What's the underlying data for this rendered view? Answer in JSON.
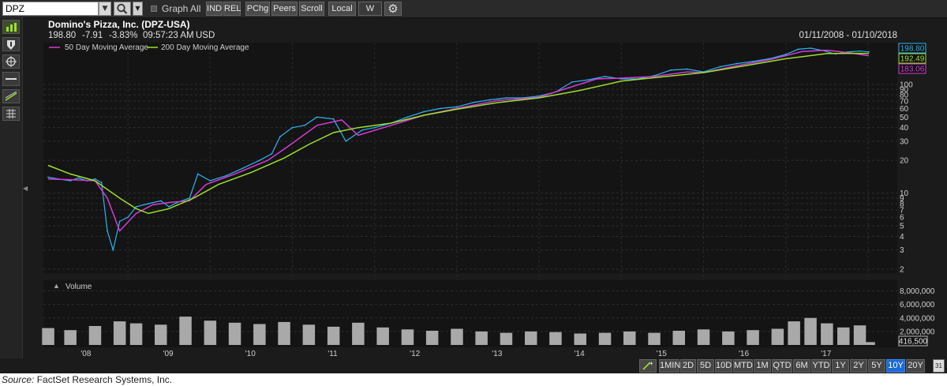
{
  "toolbar": {
    "ticker": "DPZ",
    "graph_all_label": "Graph All",
    "buttons": [
      "IND",
      "REL",
      "PChg",
      "Peers",
      "Scroll",
      "Local",
      "W"
    ]
  },
  "header": {
    "title": "Domino's Pizza, Inc. (DPZ-USA)",
    "price": "198.80",
    "change": "-7.91",
    "change_pct": "-3.83%",
    "time": "09:57:23 AM",
    "currency": "USD",
    "date_range": "01/11/2008 - 01/10/2018"
  },
  "legend": [
    {
      "label": "50 Day Moving Average",
      "color": "#d63bd6"
    },
    {
      "label": "200 Day Moving Average",
      "color": "#9be02a"
    }
  ],
  "price_tags": [
    {
      "value": "198.80",
      "color": "#2db4f0"
    },
    {
      "value": "192.49",
      "color": "#9be02a"
    },
    {
      "value": "183.06",
      "color": "#d63bd6"
    }
  ],
  "volume_label": "Volume",
  "volume_last": "416,500",
  "range_buttons": [
    "1MIN",
    "2D",
    "5D",
    "10D",
    "MTD",
    "1M",
    "QTD",
    "6M",
    "YTD",
    "1Y",
    "2Y",
    "5Y",
    "10Y",
    "20Y"
  ],
  "active_range": "10Y",
  "calendar_label": "31",
  "source": {
    "label": "Source:",
    "text": " FactSet Research Systems, Inc."
  },
  "colors": {
    "price": "#2db4f0",
    "ma50": "#d63bd6",
    "ma200": "#9be02a",
    "volume": "#a9a9a9",
    "active": "#1e6bd6"
  },
  "chart_data": {
    "type": "line",
    "title": "Domino's Pizza, Inc. (DPZ-USA)",
    "scale": "log",
    "x_labels": [
      "'08",
      "'09",
      "'10",
      "'11",
      "'12",
      "'13",
      "'14",
      "'15",
      "'16",
      "'17"
    ],
    "y_ticks": [
      2,
      3,
      4,
      5,
      6,
      7,
      8,
      9,
      10,
      20,
      30,
      40,
      50,
      60,
      70,
      80,
      90,
      100
    ],
    "series": [
      {
        "name": "DPZ",
        "x": [
          2008.03,
          2008.15,
          2008.3,
          2008.4,
          2008.5,
          2008.6,
          2008.68,
          2008.75,
          2008.82,
          2008.9,
          2009.0,
          2009.1,
          2009.25,
          2009.4,
          2009.5,
          2009.6,
          2009.75,
          2009.85,
          2010.0,
          2010.2,
          2010.4,
          2010.6,
          2010.75,
          2010.85,
          2011.0,
          2011.15,
          2011.3,
          2011.5,
          2011.65,
          2011.85,
          2012.0,
          2012.2,
          2012.4,
          2012.6,
          2012.8,
          2013.0,
          2013.2,
          2013.4,
          2013.6,
          2013.8,
          2014.0,
          2014.2,
          2014.4,
          2014.6,
          2014.8,
          2015.0,
          2015.2,
          2015.4,
          2015.6,
          2015.8,
          2016.0,
          2016.2,
          2016.4,
          2016.6,
          2016.8,
          2017.0,
          2017.15,
          2017.3,
          2017.45,
          2017.6,
          2017.75,
          2017.9,
          2018.01
        ],
        "values": [
          14,
          13.5,
          13,
          13.8,
          13,
          13.5,
          12.5,
          4.5,
          3,
          5.5,
          6,
          7.5,
          8,
          8.5,
          7.5,
          8.2,
          9,
          15,
          13,
          14.5,
          17,
          20,
          23,
          33,
          40,
          42,
          50,
          48,
          30,
          38,
          40,
          44,
          50,
          56,
          60,
          62,
          68,
          72,
          75,
          75,
          78,
          85,
          105,
          110,
          118,
          112,
          112,
          120,
          135,
          138,
          130,
          145,
          155,
          162,
          172,
          188,
          210,
          215,
          205,
          190,
          198,
          202,
          198.8
        ]
      },
      {
        "name": "50 Day Moving Average",
        "x": [
          2008.03,
          2008.3,
          2008.6,
          2008.75,
          2008.9,
          2009.1,
          2009.3,
          2009.5,
          2009.75,
          2009.95,
          2010.3,
          2010.7,
          2010.95,
          2011.3,
          2011.6,
          2011.8,
          2012.2,
          2012.6,
          2013.0,
          2013.5,
          2014.0,
          2014.3,
          2014.7,
          2015.0,
          2015.4,
          2015.8,
          2016.0,
          2016.4,
          2016.8,
          2017.2,
          2017.5,
          2017.8,
          2018.01
        ],
        "values": [
          13.5,
          13.3,
          13,
          9,
          4.5,
          6.5,
          7.8,
          8.2,
          8.5,
          12,
          15,
          20,
          27,
          42,
          47,
          34,
          42,
          52,
          60,
          71,
          76,
          90,
          112,
          114,
          118,
          130,
          128,
          148,
          168,
          200,
          206,
          194,
          183.06
        ]
      },
      {
        "name": "200 Day Moving Average",
        "x": [
          2008.03,
          2008.3,
          2008.6,
          2008.9,
          2009.1,
          2009.25,
          2009.5,
          2009.8,
          2010.1,
          2010.5,
          2010.9,
          2011.2,
          2011.5,
          2011.8,
          2012.2,
          2012.6,
          2013.0,
          2013.5,
          2014.0,
          2014.5,
          2015.0,
          2015.5,
          2016.0,
          2016.5,
          2017.0,
          2017.5,
          2018.01
        ],
        "values": [
          18,
          15,
          13,
          9,
          7.2,
          6.5,
          7.2,
          9,
          12,
          15.5,
          21,
          28,
          36,
          40,
          44,
          52,
          59,
          68,
          75,
          88,
          107,
          117,
          128,
          148,
          172,
          192,
          192.49
        ]
      }
    ],
    "volume": {
      "ylabel": "Volume",
      "y_ticks": [
        2000000,
        4000000,
        6000000,
        8000000
      ],
      "x": [
        2008.03,
        2008.3,
        2008.6,
        2008.9,
        2009.1,
        2009.4,
        2009.7,
        2010.0,
        2010.3,
        2010.6,
        2010.9,
        2011.2,
        2011.5,
        2011.8,
        2012.1,
        2012.4,
        2012.7,
        2013.0,
        2013.3,
        2013.6,
        2013.9,
        2014.2,
        2014.5,
        2014.8,
        2015.1,
        2015.4,
        2015.7,
        2016.0,
        2016.3,
        2016.6,
        2016.9,
        2017.1,
        2017.3,
        2017.5,
        2017.7,
        2017.9,
        2018.01
      ],
      "values": [
        2500000,
        2200000,
        2800000,
        3500000,
        3200000,
        3000000,
        4200000,
        3600000,
        3300000,
        3100000,
        3400000,
        3000000,
        2700000,
        3300000,
        2600000,
        2300000,
        2100000,
        2400000,
        2000000,
        1800000,
        2000000,
        1900000,
        1700000,
        1800000,
        2000000,
        1800000,
        2100000,
        2300000,
        2000000,
        2200000,
        2400000,
        3500000,
        4000000,
        3200000,
        2600000,
        2900000,
        416500
      ]
    }
  }
}
